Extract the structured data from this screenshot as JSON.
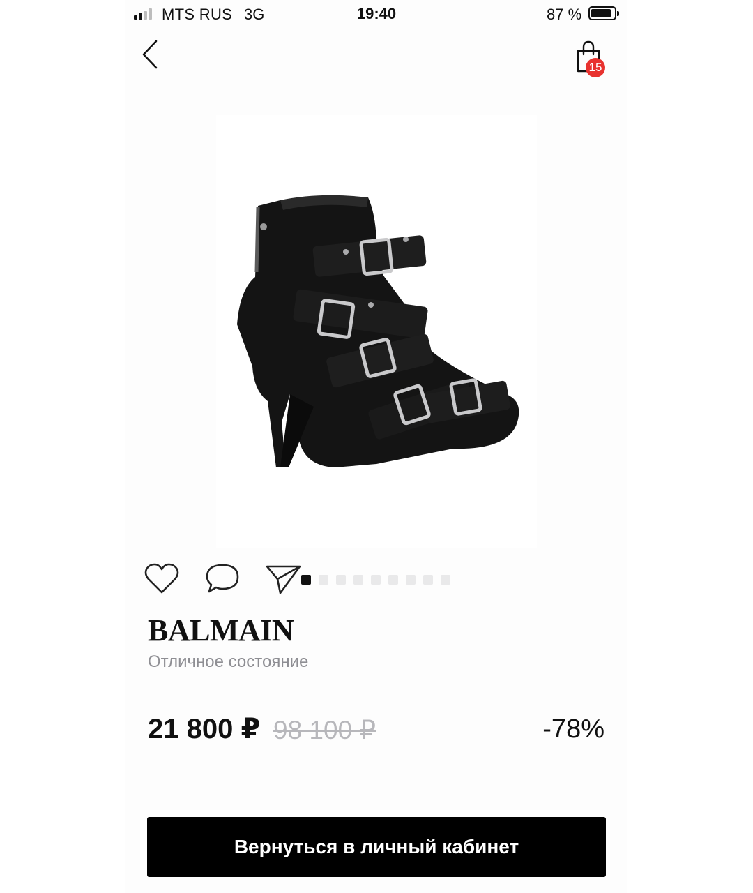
{
  "status_bar": {
    "carrier": "MTS RUS",
    "network": "3G",
    "time": "19:40",
    "battery": "87 %",
    "battery_level": 0.87
  },
  "header": {
    "back_icon": "chevron-left-icon",
    "cart_icon": "shopping-bag-icon",
    "cart_count": "15"
  },
  "product": {
    "image_alt": "black-leather-buckle-ankle-boot",
    "brand": "BALMAIN",
    "condition": "Отличное состояние",
    "price": "21 800 ₽",
    "old_price": "98 100 ₽",
    "discount": "-78%"
  },
  "actions": {
    "like_icon": "heart-icon",
    "comment_icon": "comment-icon",
    "share_icon": "send-icon"
  },
  "gallery": {
    "total": 9,
    "active_index": 0
  },
  "cta": {
    "label": "Вернуться в личный кабинет"
  },
  "colors": {
    "accent": "#000000",
    "badge": "#e8322f",
    "muted": "#8e8e93"
  }
}
